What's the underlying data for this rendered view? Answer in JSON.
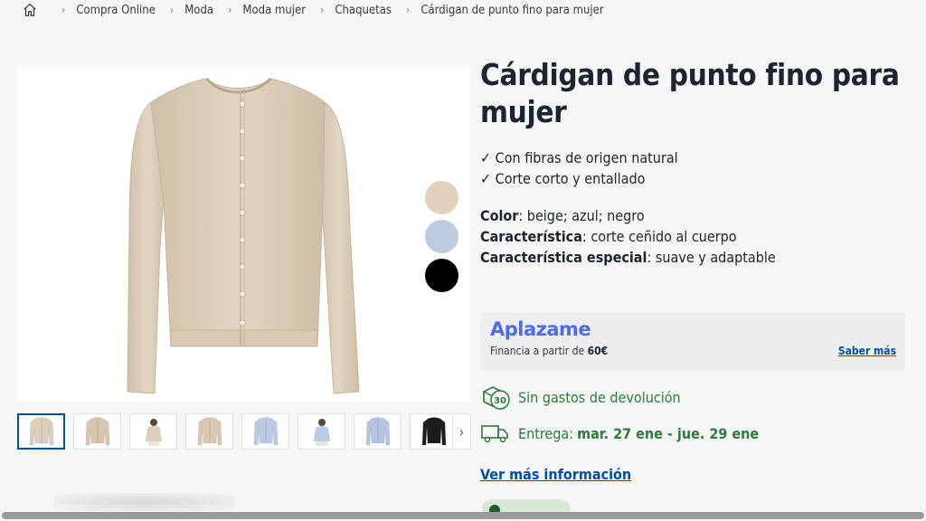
{
  "breadcrumb": {
    "items": [
      "Compra Online",
      "Moda",
      "Moda mujer",
      "Chaquetas",
      "Cárdigan de punto fino para mujer"
    ]
  },
  "product": {
    "title": "Cárdigan de punto fino para mujer",
    "benefits": [
      "✓ Con fibras de origen natural",
      "✓ Corte corto y entallado"
    ],
    "attributes": [
      {
        "label": "Color",
        "value": ": beige; azul; negro"
      },
      {
        "label": "Característica",
        "value": ": corte ceñido al cuerpo"
      },
      {
        "label": "Característica especial",
        "value": ": suave y adaptable"
      }
    ],
    "swatch_colors": [
      "#e1d2bd",
      "#bccbdd",
      "#000000"
    ],
    "main_color": "#ddd0bb"
  },
  "financing": {
    "brand": "Aplazame",
    "text_prefix": "Financia a partir de ",
    "amount": "60€",
    "link": "Saber más"
  },
  "returns": {
    "days": "30",
    "text": "Sin gastos de devolución"
  },
  "delivery": {
    "prefix": "Entrega:",
    "dates": "mar. 27 ene - jue. 29 ene"
  },
  "more_info": "Ver más información",
  "thumbnails": [
    {
      "kind": "cardigan",
      "color": "#ddd0bb"
    },
    {
      "kind": "cardigan",
      "color": "#d6c6ad"
    },
    {
      "kind": "model",
      "color": "#ddd0bb"
    },
    {
      "kind": "cardigan",
      "color": "#d9c8b0"
    },
    {
      "kind": "cardigan",
      "color": "#b9cbe4"
    },
    {
      "kind": "model",
      "color": "#b9cbe4"
    },
    {
      "kind": "cardigan",
      "color": "#b3c5e0"
    },
    {
      "kind": "cardigan",
      "color": "#1c1c1c"
    },
    {
      "kind": "cardigan",
      "color": "#cccccc"
    }
  ]
}
